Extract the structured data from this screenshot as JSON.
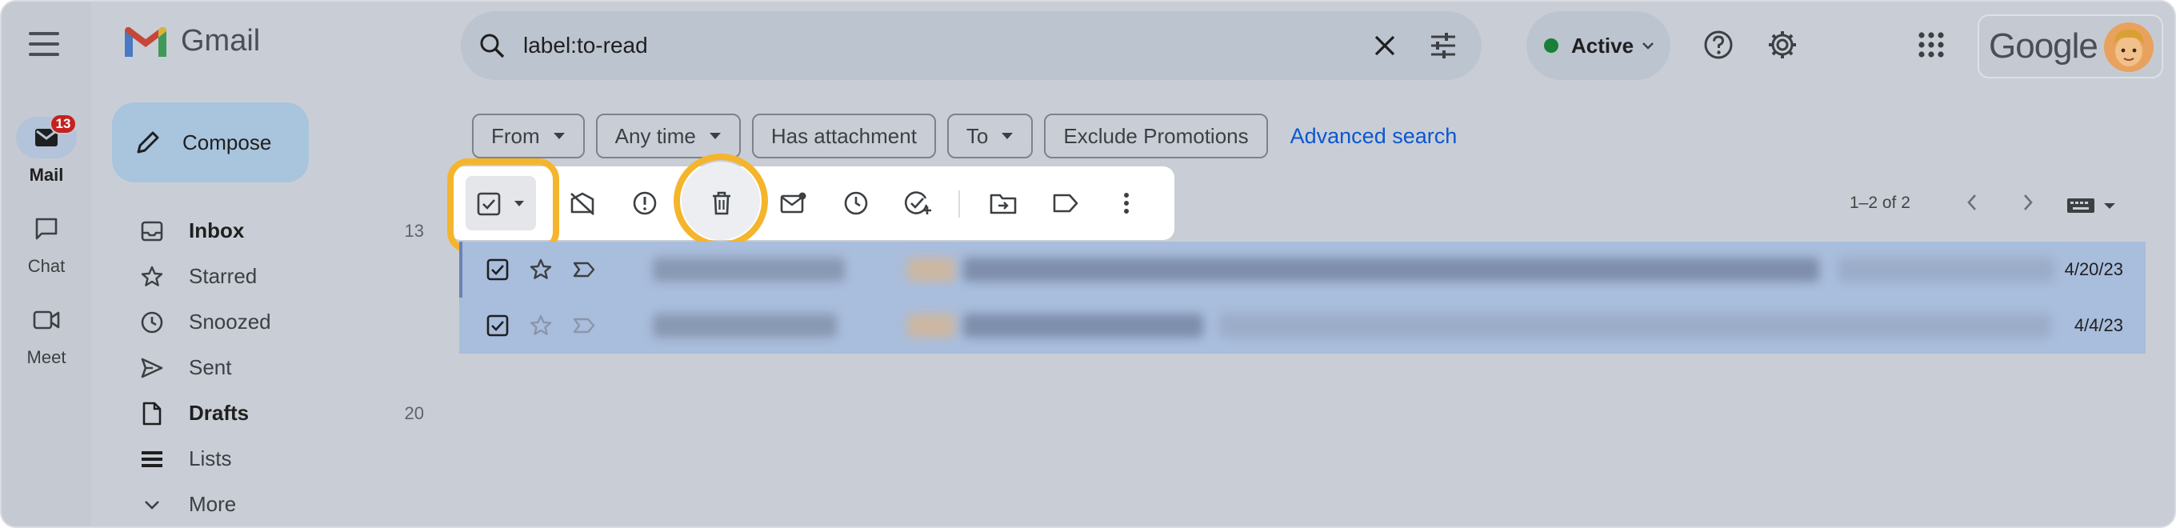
{
  "app": {
    "name": "Gmail",
    "brand": "Google"
  },
  "rail": {
    "items": [
      {
        "label": "Mail",
        "icon": "mail-icon",
        "badge": "13",
        "active": true
      },
      {
        "label": "Chat",
        "icon": "chat-icon"
      },
      {
        "label": "Meet",
        "icon": "video-icon"
      }
    ]
  },
  "compose": {
    "label": "Compose"
  },
  "nav": {
    "items": [
      {
        "label": "Inbox",
        "icon": "inbox-icon",
        "count": "13",
        "bold": true
      },
      {
        "label": "Starred",
        "icon": "star-icon"
      },
      {
        "label": "Snoozed",
        "icon": "clock-icon"
      },
      {
        "label": "Sent",
        "icon": "send-icon"
      },
      {
        "label": "Drafts",
        "icon": "draft-icon",
        "count": "20",
        "bold": true
      },
      {
        "label": "Lists",
        "icon": "list-icon"
      },
      {
        "label": "More",
        "icon": "chevron-down-icon"
      }
    ]
  },
  "search": {
    "value": "label:to-read"
  },
  "status": {
    "label": "Active",
    "color": "#188038"
  },
  "filters": {
    "chips": [
      {
        "label": "From",
        "dropdown": true
      },
      {
        "label": "Any time",
        "dropdown": true
      },
      {
        "label": "Has attachment",
        "dropdown": false
      },
      {
        "label": "To",
        "dropdown": true
      },
      {
        "label": "Exclude Promotions",
        "dropdown": false
      }
    ],
    "advanced_link": "Advanced search"
  },
  "toolbar": {
    "icons": [
      "select-all-checkbox-icon",
      "mark-as-unread-icon",
      "report-spam-icon",
      "delete-icon",
      "mark-unread-mail-icon",
      "snooze-icon",
      "add-to-tasks-icon",
      "move-to-icon",
      "label-icon",
      "more-vert-icon"
    ],
    "highlight_color": "#f4b52d"
  },
  "pagination": {
    "range": "1–2 of 2"
  },
  "messages": [
    {
      "selected": true,
      "starred": false,
      "date": "4/20/23"
    },
    {
      "selected": true,
      "starred": false,
      "date": "4/4/23"
    }
  ]
}
